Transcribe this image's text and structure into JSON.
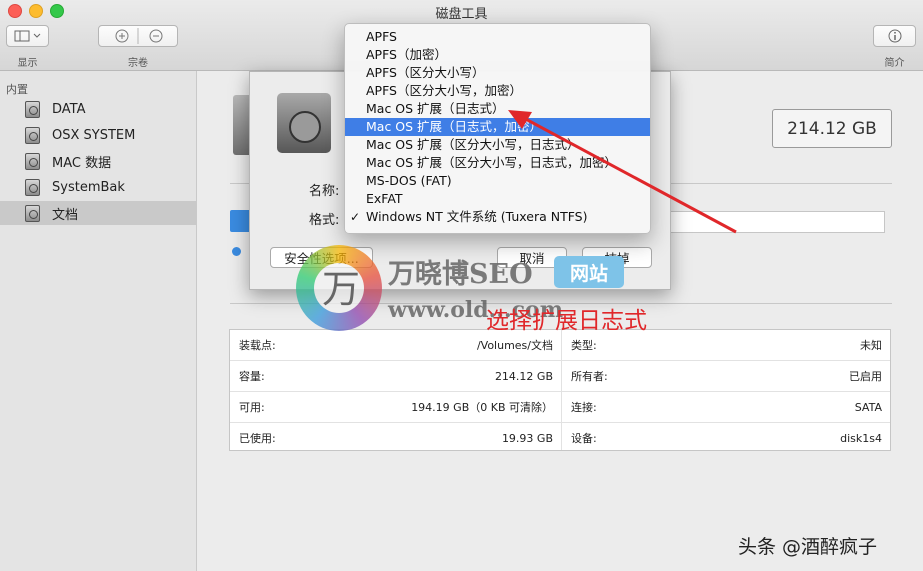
{
  "window": {
    "title": "磁盘工具"
  },
  "toolbar": {
    "view_label": "显示",
    "volume_label": "宗卷",
    "info_label": "简介"
  },
  "sidebar": {
    "section": "内置",
    "items": [
      {
        "label": "DATA"
      },
      {
        "label": "OSX SYSTEM"
      },
      {
        "label": "MAC 数据"
      },
      {
        "label": "SystemBak"
      },
      {
        "label": "文档"
      }
    ]
  },
  "main": {
    "capacity": "214.12 GB"
  },
  "dialog": {
    "name_label": "名称:",
    "format_label": "格式:",
    "security_button": "安全性选项...",
    "cancel_button": "取消",
    "erase_button": "抹掉"
  },
  "format_menu": {
    "options": [
      {
        "label": "APFS"
      },
      {
        "label": "APFS（加密）"
      },
      {
        "label": "APFS（区分大小写）"
      },
      {
        "label": "APFS（区分大小写，加密）"
      },
      {
        "label": "Mac OS 扩展（日志式）"
      },
      {
        "label": "Mac OS 扩展（日志式，加密）"
      },
      {
        "label": "Mac OS 扩展（区分大小写，日志式）"
      },
      {
        "label": "Mac OS 扩展（区分大小写，日志式，加密）"
      },
      {
        "label": "MS-DOS (FAT)"
      },
      {
        "label": "ExFAT"
      },
      {
        "label": "Windows NT 文件系统 (Tuxera NTFS)"
      }
    ],
    "highlighted": "Mac OS 扩展（日志式，加密）",
    "checked": "Windows NT 文件系统 (Tuxera NTFS)",
    "check_mark": "✓"
  },
  "info_table": {
    "left": [
      {
        "key": "装载点:",
        "value": "/Volumes/文档"
      },
      {
        "key": "容量:",
        "value": "214.12 GB"
      },
      {
        "key": "可用:",
        "value": "194.19 GB（0 KB 可清除）"
      },
      {
        "key": "已使用:",
        "value": "19.93 GB"
      }
    ],
    "right": [
      {
        "key": "类型:",
        "value": "未知"
      },
      {
        "key": "所有者:",
        "value": "已启用"
      },
      {
        "key": "连接:",
        "value": "SATA"
      },
      {
        "key": "设备:",
        "value": "disk1s4"
      }
    ]
  },
  "watermark": {
    "char": "万",
    "title": "万晓博SEO",
    "badge": "网站",
    "url": "www.old...com"
  },
  "annotation": {
    "text": "选择扩展日志式",
    "color": "#e0272a"
  },
  "footer": {
    "text": "头条 @酒醉疯子"
  },
  "colors": {
    "highlight": "#3f7ee6",
    "accent": "#3a8be0",
    "arrow": "#e0272a"
  }
}
